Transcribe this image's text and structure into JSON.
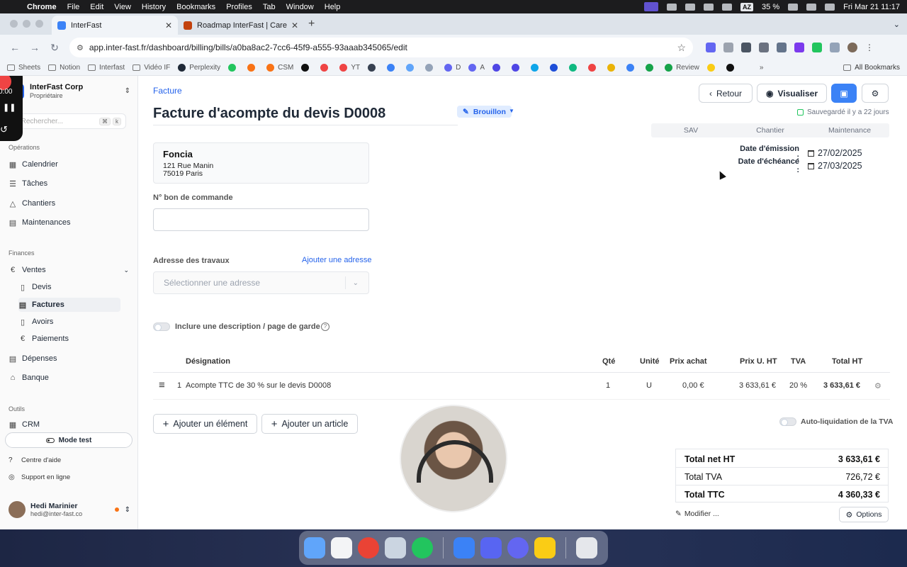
{
  "menubar": {
    "app": "Chrome",
    "items": [
      "File",
      "Edit",
      "View",
      "History",
      "Bookmarks",
      "Profiles",
      "Tab",
      "Window",
      "Help"
    ],
    "keyboard": "AZ",
    "battery": "35 %",
    "clock": "Fri Mar 21  11:17"
  },
  "browser": {
    "tabs": [
      {
        "title": "InterFast",
        "active": true,
        "color": "#3b82f6"
      },
      {
        "title": "Roadmap InterFast | Care",
        "active": false,
        "color": "#c2410c"
      }
    ],
    "url": "app.inter-fast.fr/dashboard/billing/bills/a0ba8ac2-7cc6-45f9-a555-93aaab345065/edit",
    "bookmarks": [
      "Sheets",
      "Notion",
      "Interfast",
      "Vidéo IF",
      "Perplexity",
      "CSM",
      "YT",
      "D",
      "A",
      "Review"
    ],
    "all_bookmarks": "All Bookmarks"
  },
  "recorder": {
    "time": "0:00"
  },
  "sidebar": {
    "org_name": "InterFast Corp",
    "org_role": "Propriétaire",
    "search_placeholder": "Rechercher...",
    "search_keys": [
      "⌘",
      "k"
    ],
    "sections": {
      "operations": "Opérations",
      "finances": "Finances",
      "outils": "Outils"
    },
    "operations": [
      {
        "label": "Calendrier",
        "icon": "calendar-icon"
      },
      {
        "label": "Tâches",
        "icon": "tasks-icon"
      },
      {
        "label": "Chantiers",
        "icon": "site-icon"
      },
      {
        "label": "Maintenances",
        "icon": "maintenance-icon"
      }
    ],
    "ventes": "Ventes",
    "ventes_sub": [
      "Devis",
      "Factures",
      "Avoirs",
      "Paiements"
    ],
    "active_sub": "Factures",
    "finances_other": [
      "Dépenses",
      "Banque"
    ],
    "outils": [
      "CRM"
    ],
    "mode_test": "Mode test",
    "help": "Centre d'aide",
    "support": "Support en ligne",
    "user_name": "Hedi Marinier",
    "user_email": "hedi@inter-fast.co"
  },
  "page": {
    "breadcrumb": "Facture",
    "title": "Facture d'acompte du devis D0008",
    "status": "Brouillon",
    "back": "Retour",
    "preview": "Visualiser",
    "saved": "Sauvegardé il y a 22 jours",
    "segments": [
      "SAV",
      "Chantier",
      "Maintenance"
    ],
    "issue_label": "Date d'émission :",
    "issue_date": "27/02/2025",
    "due_label": "Date d'échéance :",
    "due_date": "27/03/2025",
    "client": {
      "name": "Foncia",
      "street": "121 Rue Manin",
      "city": "75019 Paris"
    },
    "po_label": "N° bon de commande",
    "po_value": "",
    "address_label": "Adresse des travaux",
    "add_address": "Ajouter une adresse",
    "address_placeholder": "Sélectionner une adresse",
    "include_desc": "Inclure une description / page de garde",
    "columns": {
      "designation": "Désignation",
      "qty": "Qté",
      "unit": "Unité",
      "buy": "Prix achat",
      "unit_price": "Prix U. HT",
      "tva": "TVA",
      "total": "Total HT"
    },
    "rows": [
      {
        "num": "1",
        "designation": "Acompte TTC de 30 % sur le devis D0008",
        "qty": "1",
        "unit": "U",
        "buy": "0,00 €",
        "unit_price": "3 633,61 €",
        "tva": "20 %",
        "total": "3 633,61 €"
      }
    ],
    "add_element": "Ajouter un élément",
    "add_article": "Ajouter un article",
    "reverse_charge": "Auto-liquidation de la TVA",
    "totals": {
      "net_label": "Total net HT",
      "net": "3 633,61 €",
      "tva_label": "Total TVA",
      "tva": "726,72 €",
      "ttc_label": "Total TTC",
      "ttc": "4 360,33 €"
    },
    "modify": "Modifier ...",
    "options": "Options"
  },
  "colors": {
    "accent": "#3b82f6",
    "link": "#2563eb",
    "status_bg": "#e0ecff"
  },
  "dock": {
    "apps": [
      "finder",
      "launchpad",
      "chrome",
      "notes",
      "whatsapp",
      "arc",
      "discord",
      "perplexity",
      "keep",
      "trash"
    ]
  }
}
